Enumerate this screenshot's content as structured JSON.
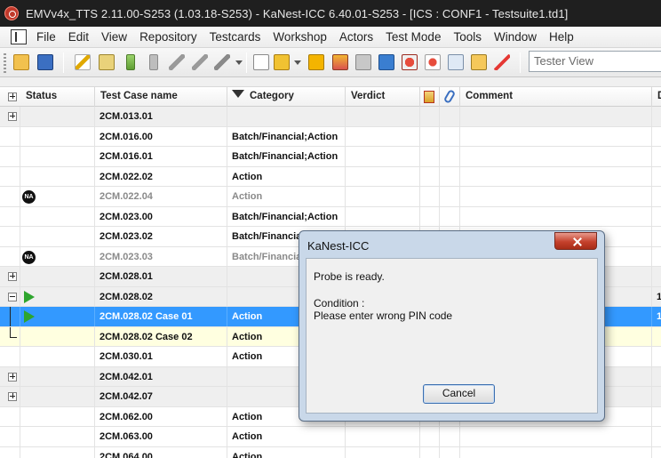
{
  "window": {
    "title": "EMVv4x_TTS 2.11.00-S253 (1.03.18-S253)  - KaNest-ICC 6.40.01-S253 - [ICS : CONF1 - Testsuite1.td1]"
  },
  "menu": [
    "File",
    "Edit",
    "View",
    "Repository",
    "Testcards",
    "Workshop",
    "Actors",
    "Test Mode",
    "Tools",
    "Window",
    "Help"
  ],
  "toolbar": {
    "view_select": "Tester View"
  },
  "table": {
    "columns": [
      "Status",
      "Test Case name",
      "Category",
      "Verdict",
      "",
      "",
      "Comment",
      "D"
    ],
    "rows": [
      {
        "name": "2CM.013.01",
        "category": "",
        "kind": "group"
      },
      {
        "name": "2CM.016.00",
        "category": "Batch/Financial;Action",
        "kind": "normal"
      },
      {
        "name": "2CM.016.01",
        "category": "Batch/Financial;Action",
        "kind": "normal"
      },
      {
        "name": "2CM.022.02",
        "category": "Action",
        "kind": "normal"
      },
      {
        "name": "2CM.022.04",
        "category": "Action",
        "kind": "na"
      },
      {
        "name": "2CM.023.00",
        "category": "Batch/Financial;Action",
        "kind": "normal"
      },
      {
        "name": "2CM.023.02",
        "category": "Batch/Financial",
        "kind": "normal"
      },
      {
        "name": "2CM.023.03",
        "category": "Batch/Financial",
        "kind": "na"
      },
      {
        "name": "2CM.028.01",
        "category": "",
        "kind": "group"
      },
      {
        "name": "2CM.028.02",
        "category": "",
        "kind": "group-open",
        "extra": "1"
      },
      {
        "name": "2CM.028.02 Case 01",
        "category": "Action",
        "kind": "selected",
        "extra": "1"
      },
      {
        "name": "2CM.028.02 Case 02",
        "category": "Action",
        "kind": "sub"
      },
      {
        "name": "2CM.030.01",
        "category": "Action",
        "kind": "normal"
      },
      {
        "name": "2CM.042.01",
        "category": "",
        "kind": "group"
      },
      {
        "name": "2CM.042.07",
        "category": "",
        "kind": "group"
      },
      {
        "name": "2CM.062.00",
        "category": "Action",
        "kind": "normal"
      },
      {
        "name": "2CM.063.00",
        "category": "Action",
        "kind": "normal"
      },
      {
        "name": "2CM.064.00",
        "category": "Action",
        "kind": "normal"
      }
    ],
    "na_label": "NA"
  },
  "dialog": {
    "title": "KaNest-ICC",
    "line1": "Probe is ready.",
    "line2": "Condition :",
    "line3": "Please enter wrong PIN code",
    "cancel_label": "Cancel"
  },
  "colors": {
    "selected_row": "#3399ff",
    "sub_row": "#ffffe0",
    "group_row": "#efefef",
    "play_green": "#2ea52e"
  }
}
